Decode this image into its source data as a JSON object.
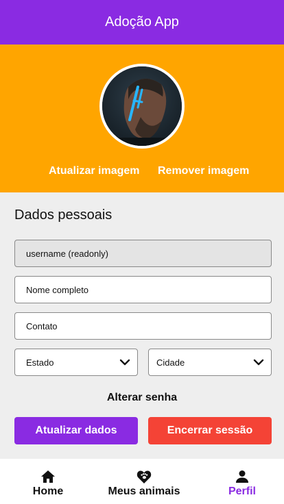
{
  "app": {
    "title": "Adoção App"
  },
  "profile": {
    "update_image_label": "Atualizar imagem",
    "remove_image_label": "Remover imagem"
  },
  "personal": {
    "section_title": "Dados pessoais",
    "username_value": "username (readonly)",
    "fullname_placeholder": "Nome completo",
    "contact_placeholder": "Contato",
    "state_label": "Estado",
    "city_label": "Cidade",
    "change_password_label": "Alterar senha",
    "update_button": "Atualizar dados",
    "logout_button": "Encerrar sessão"
  },
  "nav": {
    "items": [
      {
        "label": "Home",
        "icon": "home-icon",
        "active": false
      },
      {
        "label": "Meus animais",
        "icon": "heart-paw-icon",
        "active": false
      },
      {
        "label": "Perfil",
        "icon": "person-icon",
        "active": true
      }
    ]
  },
  "colors": {
    "primary": "#8a2be2",
    "header_bg": "#ffa500",
    "danger": "#f44336",
    "background": "#eeeeee"
  }
}
